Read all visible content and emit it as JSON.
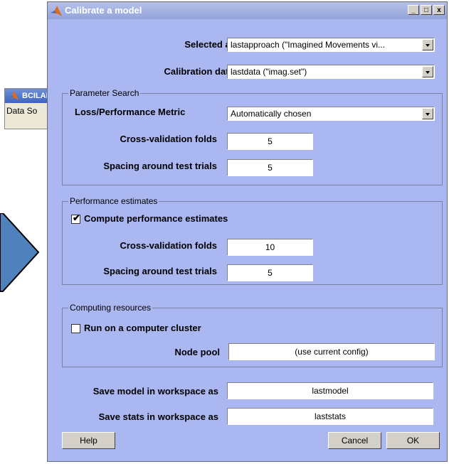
{
  "background_window": {
    "title": "BCILAB",
    "menu_item": "Data So"
  },
  "dialog": {
    "title": "Calibrate a model",
    "selected_approach": {
      "label": "Selected approach",
      "value": "lastapproach (\"Imagined Movements vi..."
    },
    "calibration_source": {
      "label": "Calibration data source",
      "value": "lastdata (\"imag.set\")"
    },
    "parameter_search": {
      "title": "Parameter Search",
      "metric_label": "Loss/Performance Metric",
      "metric_value": "Automatically chosen",
      "folds_label": "Cross-validation folds",
      "folds_value": "5",
      "spacing_label": "Spacing around test trials",
      "spacing_value": "5"
    },
    "performance": {
      "title": "Performance estimates",
      "compute_label": "Compute performance estimates",
      "compute_checked": true,
      "folds_label": "Cross-validation folds",
      "folds_value": "10",
      "spacing_label": "Spacing around test trials",
      "spacing_value": "5"
    },
    "computing": {
      "title": "Computing resources",
      "cluster_label": "Run on a computer cluster",
      "cluster_checked": false,
      "node_pool_label": "Node pool",
      "node_pool_value": "(use current config)"
    },
    "save_model": {
      "label": "Save model in workspace as",
      "value": "lastmodel"
    },
    "save_stats": {
      "label": "Save stats in workspace as",
      "value": "laststats"
    },
    "buttons": {
      "help": "Help",
      "cancel": "Cancel",
      "ok": "OK"
    },
    "window_buttons": {
      "minimize": "_",
      "maximize": "□",
      "close": "x"
    }
  },
  "colors": {
    "dialog_bg": "#aab7f0",
    "arrow": "#4f81bd"
  }
}
